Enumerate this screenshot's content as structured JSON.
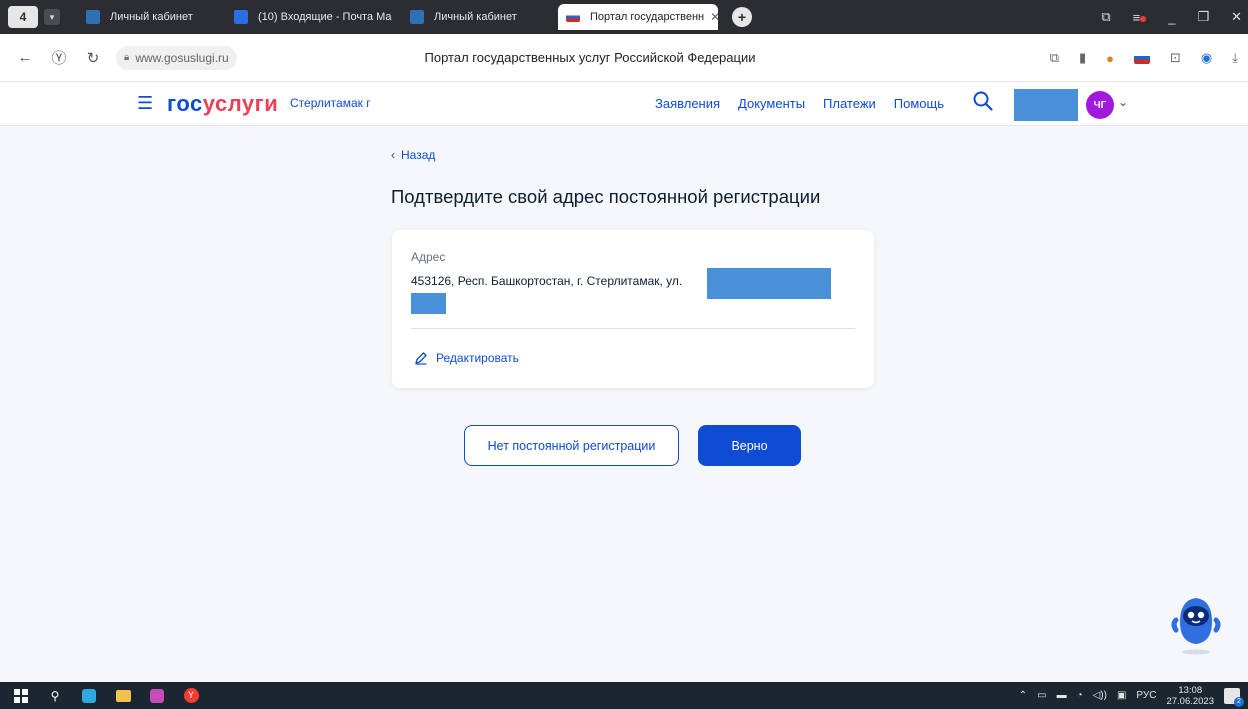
{
  "browser": {
    "brand_badge": "4",
    "tabs": [
      {
        "title": "Личный кабинет",
        "favicon_color": "#2f6fb6",
        "active": false
      },
      {
        "title": "(10) Входящие - Почта Ма",
        "favicon_color": "#2a6fe0",
        "active": false
      },
      {
        "title": "Личный кабинет",
        "favicon_color": "#2f6fb6",
        "active": false
      },
      {
        "title": "Портал государственн",
        "favicon_color": "#d52b1e",
        "active": true
      }
    ],
    "new_tab_label": "+",
    "url": "www.gosuslugi.ru",
    "page_title": "Портал государственных услуг Российской Федерации"
  },
  "site": {
    "logo_part1": "гос",
    "logo_part2": "услуги",
    "city": "Стерлитамак г",
    "nav": [
      "Заявления",
      "Документы",
      "Платежи",
      "Помощь"
    ],
    "avatar_initials": "ЧГ"
  },
  "page": {
    "back_label": "Назад",
    "heading": "Подтвердите свой адрес постоянной регистрации",
    "address_label": "Адрес",
    "address_value": "453126, Респ. Башкортостан, г. Стерлитамак, ул.",
    "edit_label": "Редактировать",
    "no_registration_button": "Нет постоянной регистрации",
    "confirm_button": "Верно"
  },
  "taskbar": {
    "language": "РУС",
    "time": "13:08",
    "date": "27.06.2023",
    "notifications": "2"
  },
  "colors": {
    "accent": "#0d4cd3",
    "logo_red": "#ee3f58",
    "mask": "#4a90d9",
    "avatar": "#a019dc"
  }
}
